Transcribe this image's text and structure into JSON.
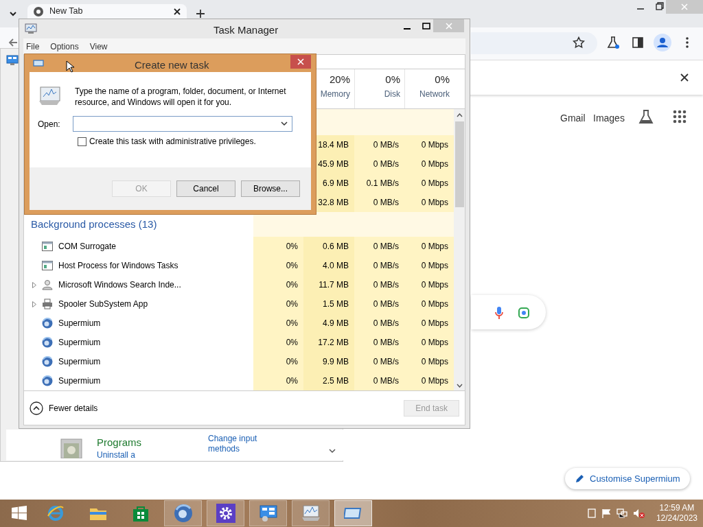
{
  "browser": {
    "tab": {
      "title": "New Tab"
    },
    "links": [
      "Gmail",
      "Images"
    ],
    "customise_button": "Customise Supermium"
  },
  "control_panel": {
    "category": {
      "title": "Programs",
      "link": "Uninstall a"
    },
    "link": "Change input methods"
  },
  "task_manager": {
    "title": "Task Manager",
    "menu": [
      "File",
      "Options",
      "View"
    ],
    "columns": [
      {
        "percent": "20%",
        "label": "Memory"
      },
      {
        "percent": "0%",
        "label": "Disk"
      },
      {
        "percent": "0%",
        "label": "Network"
      }
    ],
    "app_rows": [
      {
        "memory": "18.4 MB",
        "disk": "0 MB/s",
        "network": "0 Mbps"
      },
      {
        "memory": "45.9 MB",
        "disk": "0 MB/s",
        "network": "0 Mbps"
      },
      {
        "memory": "6.9 MB",
        "disk": "0.1 MB/s",
        "network": "0 Mbps"
      },
      {
        "memory": "32.8 MB",
        "disk": "0 MB/s",
        "network": "0 Mbps"
      }
    ],
    "group": "Background processes (13)",
    "processes": [
      {
        "name": "COM Surrogate",
        "kind": "service",
        "expandable": false,
        "cpu": "0%",
        "memory": "0.6 MB",
        "disk": "0 MB/s",
        "network": "0 Mbps"
      },
      {
        "name": "Host Process for Windows Tasks",
        "kind": "service",
        "expandable": false,
        "cpu": "0%",
        "memory": "4.0 MB",
        "disk": "0 MB/s",
        "network": "0 Mbps"
      },
      {
        "name": "Microsoft Windows Search Inde...",
        "kind": "search",
        "expandable": true,
        "cpu": "0%",
        "memory": "11.7 MB",
        "disk": "0 MB/s",
        "network": "0 Mbps"
      },
      {
        "name": "Spooler SubSystem App",
        "kind": "printer",
        "expandable": true,
        "cpu": "0%",
        "memory": "1.5 MB",
        "disk": "0 MB/s",
        "network": "0 Mbps"
      },
      {
        "name": "Supermium",
        "kind": "browser",
        "expandable": false,
        "cpu": "0%",
        "memory": "4.9 MB",
        "disk": "0 MB/s",
        "network": "0 Mbps"
      },
      {
        "name": "Supermium",
        "kind": "browser",
        "expandable": false,
        "cpu": "0%",
        "memory": "17.2 MB",
        "disk": "0 MB/s",
        "network": "0 Mbps"
      },
      {
        "name": "Supermium",
        "kind": "browser",
        "expandable": false,
        "cpu": "0%",
        "memory": "9.9 MB",
        "disk": "0 MB/s",
        "network": "0 Mbps"
      },
      {
        "name": "Supermium",
        "kind": "browser",
        "expandable": false,
        "cpu": "0%",
        "memory": "2.5 MB",
        "disk": "0 MB/s",
        "network": "0 Mbps"
      }
    ],
    "fewer_details": "Fewer details",
    "end_task": {
      "label": "End task",
      "disabled": true
    }
  },
  "dialog": {
    "title": "Create new task",
    "message": "Type the name of a program, folder, document, or Internet resource, and Windows will open it for you.",
    "open_label": "Open:",
    "admin_checkbox": {
      "label": "Create this task with administrative privileges.",
      "checked": false
    },
    "buttons": [
      {
        "label": "OK",
        "disabled": true
      },
      {
        "label": "Cancel",
        "disabled": false
      },
      {
        "label": "Browse...",
        "disabled": false
      }
    ]
  },
  "taskbar": {
    "items": [
      {
        "kind": "start",
        "running": false,
        "selected": false
      },
      {
        "kind": "ie",
        "running": false,
        "selected": false
      },
      {
        "kind": "explorer",
        "running": false,
        "selected": false
      },
      {
        "kind": "store",
        "running": false,
        "selected": false
      },
      {
        "kind": "browser",
        "running": true,
        "selected": false
      },
      {
        "kind": "settings",
        "running": true,
        "selected": false
      },
      {
        "kind": "control-panel",
        "running": true,
        "selected": false
      },
      {
        "kind": "task-manager",
        "running": true,
        "selected": false
      },
      {
        "kind": "run",
        "running": true,
        "selected": true
      }
    ],
    "clock": {
      "time": "12:59 AM",
      "date": "12/24/2023"
    }
  }
}
